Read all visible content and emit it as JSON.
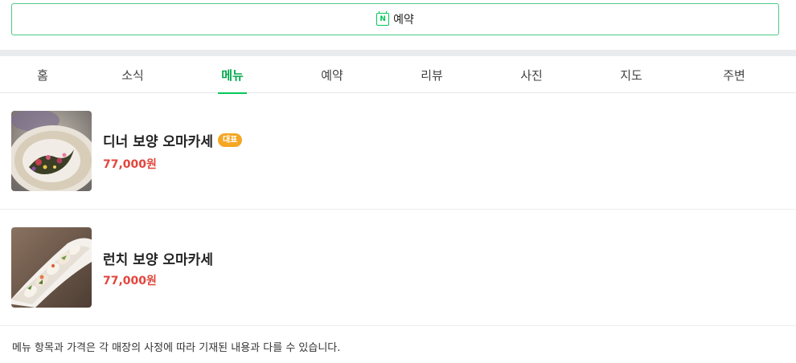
{
  "reserve_button": {
    "icon": "naver-calendar-icon",
    "icon_letter": "N",
    "label": "예약",
    "border_color": "#4fc98a"
  },
  "tabs": [
    {
      "label": "홈",
      "active": false
    },
    {
      "label": "소식",
      "active": false
    },
    {
      "label": "메뉴",
      "active": true
    },
    {
      "label": "예약",
      "active": false
    },
    {
      "label": "리뷰",
      "active": false
    },
    {
      "label": "사진",
      "active": false
    },
    {
      "label": "지도",
      "active": false
    },
    {
      "label": "주변",
      "active": false
    }
  ],
  "menu_items": [
    {
      "name": "디너 보양 오마카세",
      "badge": "대표",
      "price": "77,000원"
    },
    {
      "name": "런치 보양 오마카세",
      "badge": "",
      "price": "77,000원"
    }
  ],
  "notice": "메뉴 항목과 가격은 각 매장의 사정에 따라 기재된 내용과 다를 수 있습니다.",
  "colors": {
    "accent": "#03c75a",
    "price": "#e2453c",
    "badge": "#f5a623"
  }
}
